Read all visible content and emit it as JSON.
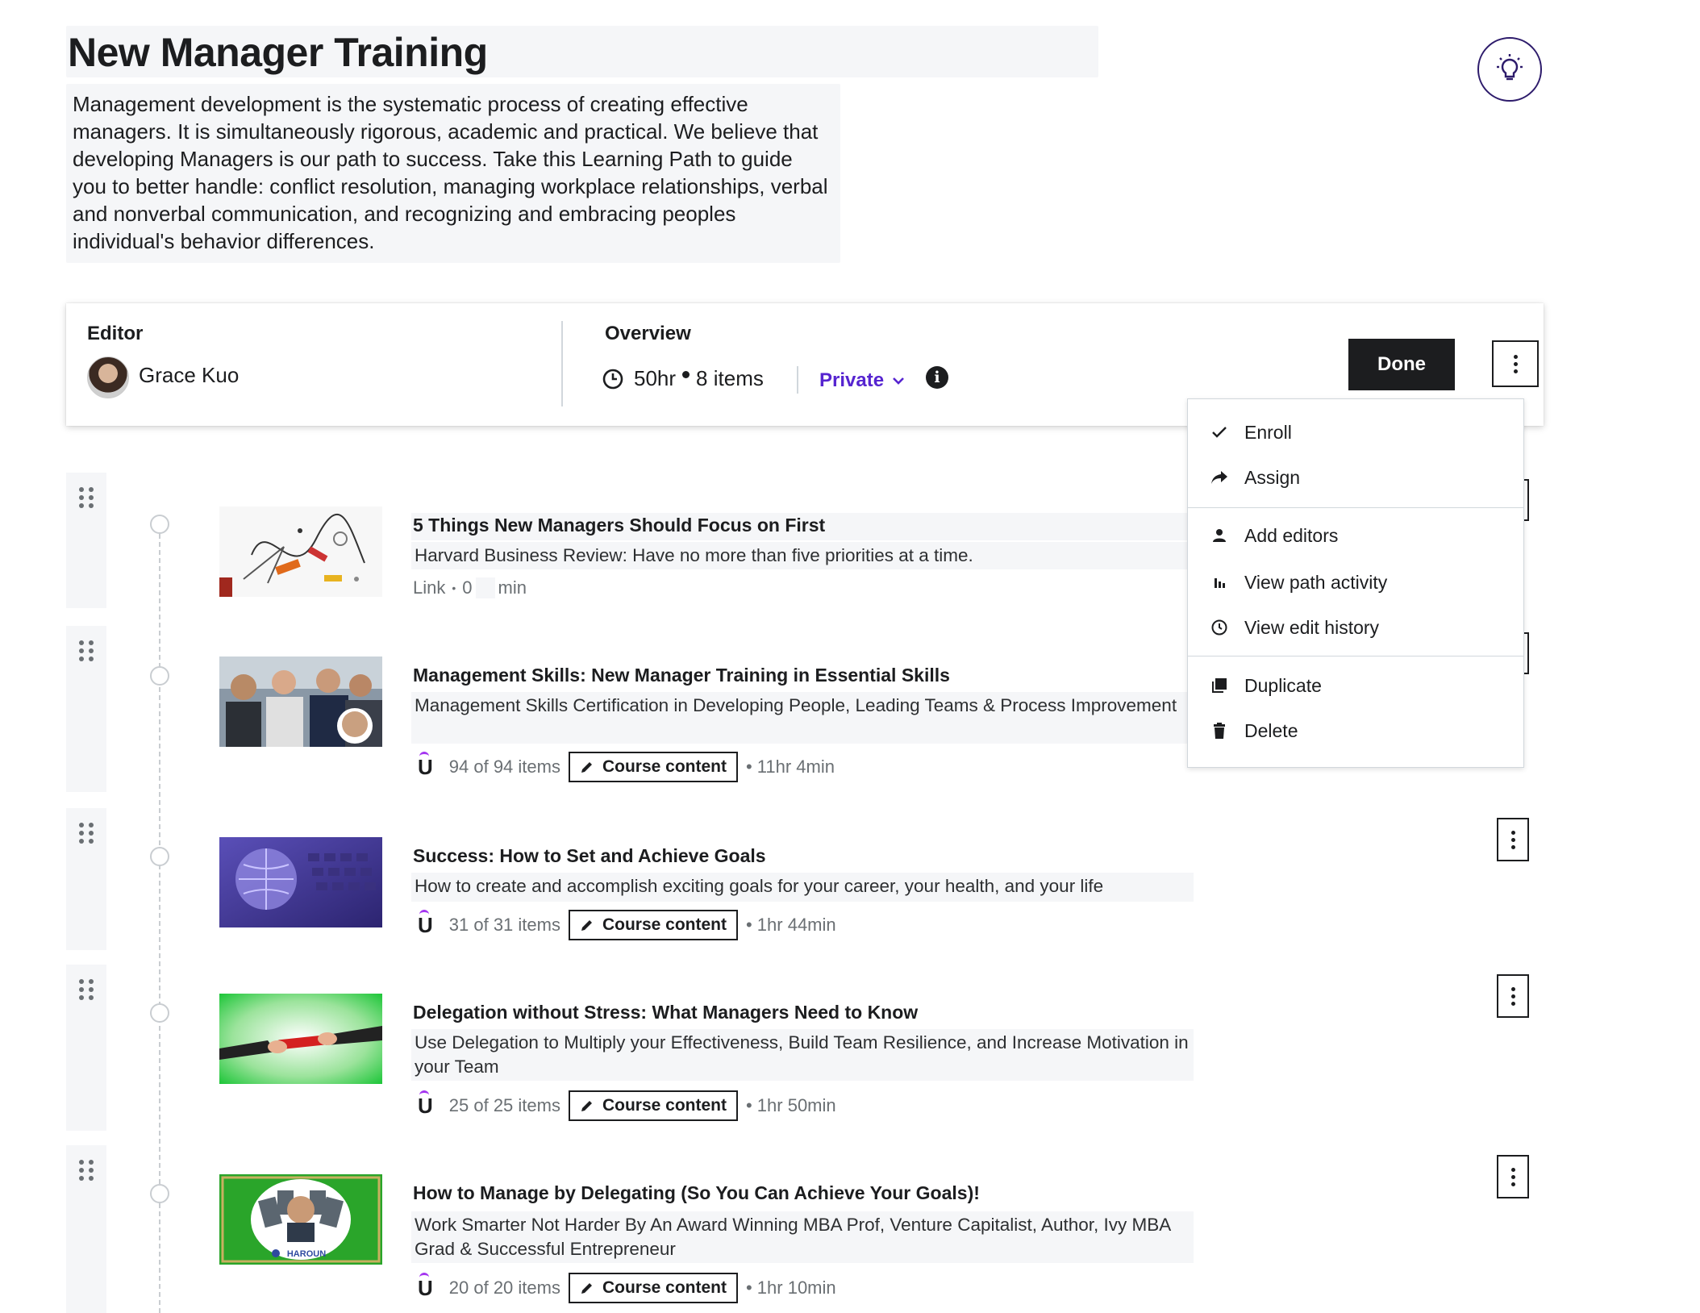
{
  "header": {
    "title": "New Manager Training",
    "description": "Management development is the systematic process of creating effective managers. It is simultaneously rigorous, academic and practical. We believe that developing Managers is our path to success. Take this Learning Path to guide you to better handle: conflict resolution, managing workplace relationships, verbal and nonverbal communication, and recognizing and embracing peoples individual's behavior differences.",
    "help_icon": "lightbulb-icon"
  },
  "overview": {
    "editor_label": "Editor",
    "editor_name": "Grace Kuo",
    "overview_label": "Overview",
    "duration": "50hr",
    "item_count": "8 items",
    "privacy": "Private",
    "done_label": "Done"
  },
  "menu": {
    "items": [
      {
        "label": "Enroll",
        "icon": "check-icon"
      },
      {
        "label": "Assign",
        "icon": "share-arrow-icon"
      },
      {
        "label": "Add editors",
        "icon": "person-icon"
      },
      {
        "label": "View path activity",
        "icon": "bar-chart-icon"
      },
      {
        "label": "View edit history",
        "icon": "clock-icon"
      },
      {
        "label": "Duplicate",
        "icon": "duplicate-icon"
      },
      {
        "label": "Delete",
        "icon": "trash-icon"
      }
    ]
  },
  "items": [
    {
      "title": "5 Things New Managers Should Focus on First",
      "subtitle": "Harvard Business Review: Have no more than five priorities at a time.",
      "type": "Link",
      "sep": "•",
      "minutes": "0",
      "unit": "min"
    },
    {
      "title": "Management Skills: New Manager Training in Essential Skills",
      "subtitle": "Management Skills Certification in Developing People, Leading Teams & Process Improvement",
      "progress": "94 of 94 items",
      "button": "Course content",
      "duration": "• 11hr 4min"
    },
    {
      "title": "Success: How to Set and Achieve Goals",
      "subtitle": "How to create and accomplish exciting goals for your career, your health, and your life",
      "progress": "31 of 31 items",
      "button": "Course content",
      "duration": "• 1hr 44min"
    },
    {
      "title": "Delegation without Stress: What Managers Need to Know",
      "subtitle": "Use Delegation to Multiply your Effectiveness, Build Team Resilience, and Increase Motivation in your Team",
      "progress": "25 of 25 items",
      "button": "Course content",
      "duration": "• 1hr 50min"
    },
    {
      "title": "How to Manage by Delegating (So You Can Achieve Your Goals)!",
      "subtitle": "Work Smarter Not Harder By An Award Winning MBA Prof, Venture Capitalist, Author, Ivy MBA Grad & Successful Entrepreneur",
      "progress": "20 of 20 items",
      "button": "Course content",
      "duration": "• 1hr 10min",
      "thumb_text": "HAROUN"
    }
  ],
  "colors": {
    "accent": "#5624d0",
    "text": "#1c1d1f",
    "muted": "#6a6f73",
    "placeholder_bg": "#f5f6f8"
  }
}
